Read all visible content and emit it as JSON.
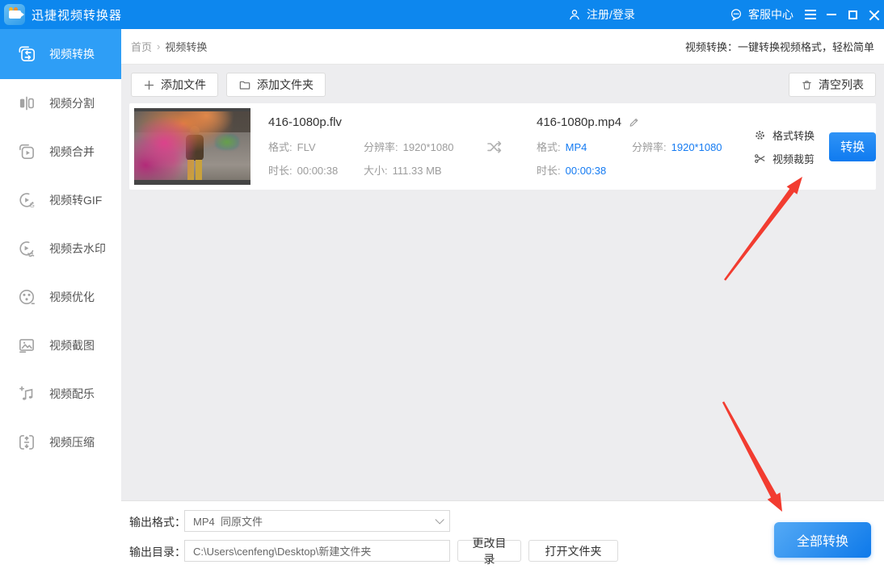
{
  "header": {
    "app_title": "迅捷视频转换器",
    "login_label": "注册/登录",
    "support_label": "客服中心"
  },
  "sidebar": {
    "items": [
      {
        "label": "视频转换",
        "icon": "video-convert-icon",
        "active": true
      },
      {
        "label": "视频分割",
        "icon": "video-split-icon",
        "active": false
      },
      {
        "label": "视频合并",
        "icon": "video-merge-icon",
        "active": false
      },
      {
        "label": "视频转GIF",
        "icon": "video-to-gif-icon",
        "active": false
      },
      {
        "label": "视频去水印",
        "icon": "remove-watermark-icon",
        "active": false
      },
      {
        "label": "视频优化",
        "icon": "video-optimize-icon",
        "active": false
      },
      {
        "label": "视频截图",
        "icon": "video-screenshot-icon",
        "active": false
      },
      {
        "label": "视频配乐",
        "icon": "video-music-icon",
        "active": false
      },
      {
        "label": "视频压缩",
        "icon": "video-compress-icon",
        "active": false
      }
    ]
  },
  "breadcrumb": {
    "home": "首页",
    "separator": "›",
    "current": "视频转换"
  },
  "tagline": "视频转换：一键转换视频格式，轻松简单",
  "toolbar": {
    "add_file": "添加文件",
    "add_folder": "添加文件夹",
    "clear_list": "清空列表"
  },
  "file_row": {
    "source": {
      "name": "416-1080p.flv",
      "format_label": "格式:",
      "format": "FLV",
      "resolution_label": "分辨率:",
      "resolution": "1920*1080",
      "duration_label": "时长:",
      "duration": "00:00:38",
      "size_label": "大小:",
      "size": "111.33 MB"
    },
    "output": {
      "name": "416-1080p.mp4",
      "format_label": "格式:",
      "format": "MP4",
      "resolution_label": "分辨率:",
      "resolution": "1920*1080",
      "duration_label": "时长:",
      "duration": "00:00:38"
    },
    "actions": {
      "format_convert": "格式转换",
      "video_crop": "视频裁剪",
      "convert": "转换"
    }
  },
  "footer": {
    "output_format_label": "输出格式：",
    "output_format_value": "MP4  同原文件",
    "output_dir_label": "输出目录：",
    "output_dir_value": "C:\\Users\\cenfeng\\Desktop\\新建文件夹",
    "change_dir": "更改目录",
    "open_folder": "打开文件夹",
    "convert_all": "全部转换"
  },
  "colors": {
    "titlebar_blue": "#0d87ee",
    "active_item_blue": "#2e9ef6",
    "accent_link_blue": "#157bf2",
    "convert_button_blue": "#0f7bf0",
    "content_background": "#ededef",
    "annotation_arrow_red": "#f23c30"
  }
}
